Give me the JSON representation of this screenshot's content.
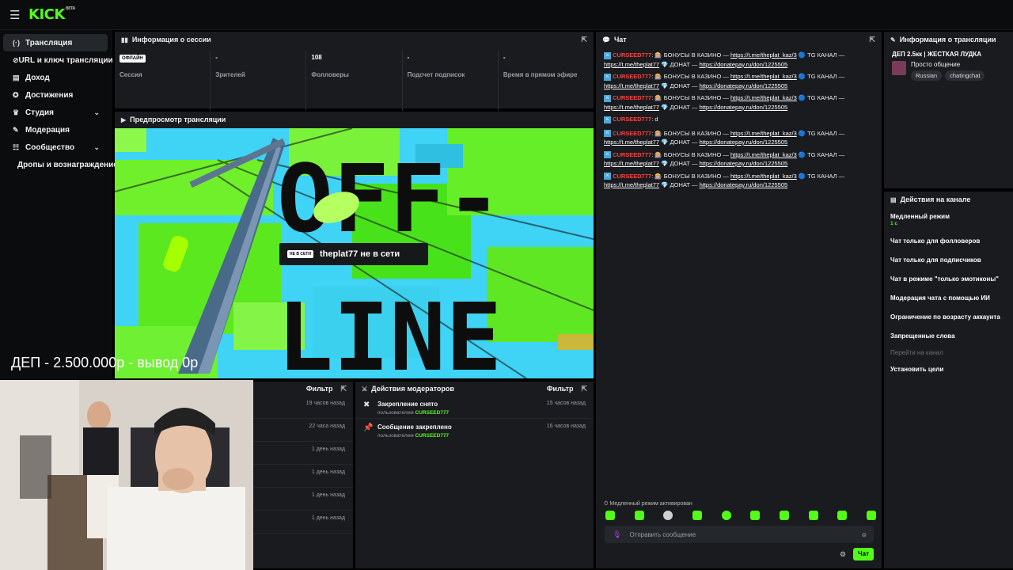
{
  "brand": {
    "logo": "KICK",
    "logo_sup": "BETA"
  },
  "sidebar": {
    "items": [
      {
        "label": "Трансляция",
        "icon": "broadcast-icon",
        "glyph": "(·)"
      },
      {
        "label": "URL и ключ трансляции",
        "icon": "key-icon",
        "glyph": "⊘"
      },
      {
        "label": "Доход",
        "icon": "chart-icon",
        "glyph": "▤"
      },
      {
        "label": "Достижения",
        "icon": "award-icon",
        "glyph": "✪"
      },
      {
        "label": "Студия",
        "icon": "trophy-icon",
        "glyph": "♛"
      },
      {
        "label": "Модерация",
        "icon": "wrench-icon",
        "glyph": "✎"
      },
      {
        "label": "Сообщество",
        "icon": "community-icon",
        "glyph": "☷"
      },
      {
        "label": "Дропы и вознаграждение",
        "icon": "",
        "glyph": ""
      }
    ]
  },
  "session_info": {
    "title": "Информация о сессии",
    "stats": [
      {
        "value": "ОФЛАЙН",
        "label": "Сессия"
      },
      {
        "value": "-",
        "label": "Зрителей"
      },
      {
        "value": "108",
        "label": "Фолловеры"
      },
      {
        "value": "-",
        "label": "Подсчет подписок"
      },
      {
        "value": "-",
        "label": "Время в прямом эфире"
      }
    ]
  },
  "preview": {
    "title": "Предпросмотр трансляции",
    "badge": "НЕ В СЕТИ",
    "text": "theplat77 не в сети",
    "poster_word1": "OFF-",
    "poster_word2": "LINE"
  },
  "overlay": {
    "caption": "ДЕП - 2.500.000р - вывод 0р"
  },
  "activity_panel": {
    "filter": "Фильтр",
    "times": [
      "19 часов назад",
      "22 часа назад",
      "1 день назад",
      "1 день назад",
      "1 день назад",
      "1 день назад"
    ]
  },
  "mod_actions": {
    "title": "Действия модераторов",
    "filter": "Фильтр",
    "rows": [
      {
        "action": "Закрепление снято",
        "by": "пользователем",
        "user": "CURSEED777",
        "time": "15 часов назад"
      },
      {
        "action": "Сообщение закреплено",
        "by": "пользователем",
        "user": "CURSEED777",
        "time": "16 часов назад"
      }
    ]
  },
  "chat": {
    "title": "Чат",
    "messages": [
      {
        "user": "CURSEED777",
        "text": ": 🎰 БОНУСЫ В КАЗИНО — ",
        "link1": "https://t.me/theplat_kaz/3",
        "mid": " 🔵 TG КАНАЛ — ",
        "link2": "https://t.me/theplat77",
        "mid2": " 💎 ДОНАТ — ",
        "link3": "https://donatepay.ru/don/1225505"
      },
      {
        "user": "CURSEED777",
        "text": ": 🎰 БОНУСЫ В КАЗИНО — ",
        "link1": "https://t.me/theplat_kaz/3",
        "mid": " 🔵 TG КАНАЛ — ",
        "link2": "https://t.me/theplat77",
        "mid2": " 💎 ДОНАТ — ",
        "link3": "https://donatepay.ru/don/1225505"
      },
      {
        "user": "CURSEED777",
        "text": ": 🎰 БОНУСЫ В КАЗИНО — ",
        "link1": "https://t.me/theplat_kaz/3",
        "mid": " 🔵 TG КАНАЛ — ",
        "link2": "https://t.me/theplat77",
        "mid2": " 💎 ДОНАТ — ",
        "link3": "https://donatepay.ru/don/1225505"
      },
      {
        "user": "CURSEED777",
        "text": ": d",
        "link1": "",
        "mid": "",
        "link2": "",
        "mid2": "",
        "link3": ""
      },
      {
        "user": "CURSEED777",
        "text": ": 🎰 БОНУСЫ В КАЗИНО — ",
        "link1": "https://t.me/theplat_kaz/3",
        "mid": " 🔵 TG КАНАЛ — ",
        "link2": "https://t.me/theplat77",
        "mid2": " 💎 ДОНАТ — ",
        "link3": "https://donatepay.ru/don/1225505"
      },
      {
        "user": "CURSEED777",
        "text": ": 🎰 БОНУСЫ В КАЗИНО — ",
        "link1": "https://t.me/theplat_kaz/3",
        "mid": " 🔵 TG КАНАЛ — ",
        "link2": "https://t.me/theplat77",
        "mid2": " 💎 ДОНАТ — ",
        "link3": "https://donatepay.ru/don/1225505"
      },
      {
        "user": "CURSEED777",
        "text": ": 🎰 БОНУСЫ В КАЗИНО — ",
        "link1": "https://t.me/theplat_kaz/3",
        "mid": " 🔵 TG КАНАЛ — ",
        "link2": "https://t.me/theplat77",
        "mid2": " 💎 ДОНАТ — ",
        "link3": "https://donatepay.ru/don/1225505"
      }
    ],
    "slow_mode_note": "Медленный режим активирован",
    "input_placeholder": "Отправить сообщение",
    "send_label": "Чат"
  },
  "stream_info": {
    "title": "Информация о трансляции",
    "stream_title": "ДЕП 2.5кк | ЖЕСТКАЯ ЛУДКА",
    "category": "Просто общение",
    "tags": [
      "Russian",
      "chatingchat"
    ]
  },
  "channel_actions": {
    "title": "Действия на канале",
    "items": [
      {
        "label": "Медленный режим",
        "sub": "1 с",
        "dim": false
      },
      {
        "label": "Чат только для фолловеров",
        "sub": "",
        "dim": false
      },
      {
        "label": "Чат только для подписчиков",
        "sub": "",
        "dim": false
      },
      {
        "label": "Чат в режиме \"только эмотиконы\"",
        "sub": "",
        "dim": false
      },
      {
        "label": "Модерация чата с помощью ИИ",
        "sub": "",
        "dim": false
      },
      {
        "label": "Ограничение по возрасту аккаунта",
        "sub": "",
        "dim": false
      },
      {
        "label": "Запрещенные слова",
        "sub": "",
        "dim": false
      },
      {
        "label": "Перейти на канал",
        "sub": "",
        "dim": true
      },
      {
        "label": "Установить цели",
        "sub": "",
        "dim": false
      }
    ]
  },
  "colors": {
    "accent": "#53fc18",
    "panel": "#191b1f",
    "username": "#ff4040"
  }
}
